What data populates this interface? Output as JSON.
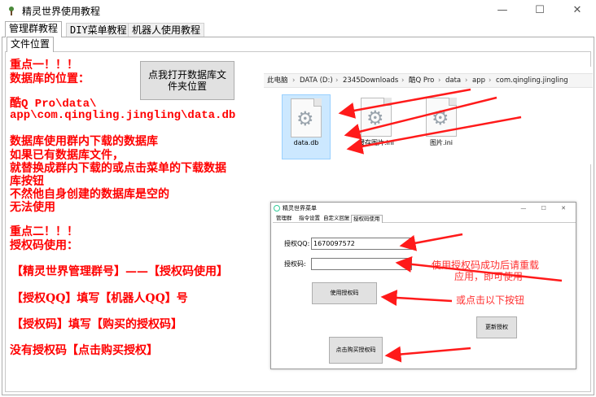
{
  "window": {
    "title": "精灵世界使用教程",
    "min_glyph": "—",
    "max_glyph": "☐",
    "close_glyph": "✕"
  },
  "tabs": [
    "管理群教程",
    "DIY菜单教程",
    "机器人使用教程"
  ],
  "subtab": "文件位置",
  "open_folder_button": {
    "line1": "点我打开数据库文",
    "line2": "件夹位置"
  },
  "instructions": {
    "key1_heading": "重点一！！！",
    "db_location": "数据库的位置：",
    "path_line1": "酷Q Pro\\data\\",
    "path_line2": "app\\com.qingling.jingling\\data.db",
    "p1": "数据库使用群内下载的数据库",
    "p2": "如果已有数据库文件，",
    "p3": "就替换成群内下载的或点击菜单的下载数据",
    "p4": "库按钮",
    "p5": "不然他自身创建的数据库是空的",
    "p6": "无法使用",
    "key2_heading": "重点二！！！",
    "authcode_use": "授权码使用：",
    "line_group": "【精灵世界管理群号】——【授权码使用】",
    "line_qq": "【授权QQ】填写【机器人QQ】号",
    "line_code": "【授权码】填写【购买的授权码】",
    "line_buy": "没有授权码【点击购买授权】"
  },
  "explorer": {
    "breadcrumb": [
      "此电脑",
      "DATA (D:)",
      "2345Downloads",
      "酷Q Pro",
      "data",
      "app",
      "com.qingling.jingling"
    ],
    "separator": "›",
    "files": [
      {
        "name": "data.db",
        "selected": true
      },
      {
        "name": "缓存图片.ini",
        "selected": false
      },
      {
        "name": "图片.ini",
        "selected": false
      }
    ]
  },
  "mini_window": {
    "title": "精灵世界菜单",
    "controls": "— ☐ ✕",
    "tabs": [
      "管理群",
      "指令设置",
      "自定义回复",
      "授权码使用"
    ],
    "auth_qq_label": "授权QQ:",
    "auth_qq_value": "1670097572",
    "auth_code_label": "授权码:",
    "auth_code_value": "",
    "use_button": "使用授权码",
    "update_button": "更新授权",
    "buy_button": "点击购买授权码"
  },
  "annotations": {
    "note1": "使用授权码成功后请重载",
    "note2": "应用，即可使用",
    "note3": "或点击以下按钮"
  },
  "colors": {
    "annotation_red": "#ff0000",
    "selection_blue": "#cce8ff"
  }
}
